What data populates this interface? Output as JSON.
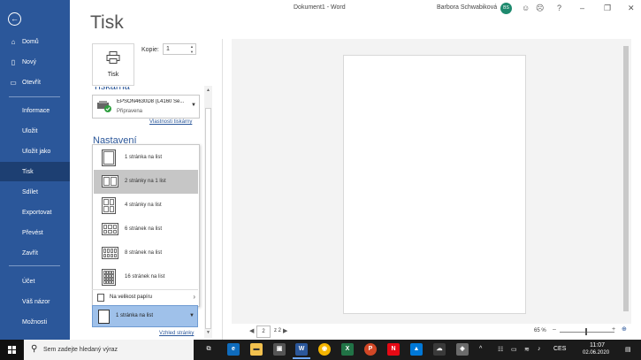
{
  "window": {
    "title": "Dokument1 - Word",
    "user": "Barbora Schwabiková",
    "initials": "BS"
  },
  "nav": {
    "items": [
      "Domů",
      "Nový",
      "Otevřít",
      "Informace",
      "Uložit",
      "Uložit jako",
      "Tisk",
      "Sdílet",
      "Exportovat",
      "Převést",
      "Zavřít",
      "Účet",
      "Váš názor",
      "Možnosti"
    ],
    "selected": "Tisk"
  },
  "page_title": "Tisk",
  "print": {
    "button_label": "Tisk",
    "copies_label": "Kopie:",
    "copies_value": "1"
  },
  "printer": {
    "section": "Tiskárna",
    "name": "EPSON4630D8 (L4160 Se...",
    "status": "Připravena",
    "properties_link": "Vlastnosti tiskárny"
  },
  "settings": {
    "section": "Nastavení",
    "pages_per_sheet_options": [
      "1 stránka na list",
      "2 stránky na 1 list",
      "4 stránky na list",
      "6 stránek na list",
      "8 stránek na list",
      "16 stránek na list"
    ],
    "highlighted_option": "2 stránky na 1 list",
    "fit_paper": "Na velikost papíru",
    "current_value": "1 stránka na list",
    "page_setup_link": "Vzhled stránky"
  },
  "status": {
    "page": "2",
    "of": "z 2",
    "zoom": "65 %"
  },
  "taskbar": {
    "search_placeholder": "Sem zadejte hledaný výraz",
    "lang": "CES",
    "time": "11:07",
    "date": "02.06.2020"
  },
  "colors": {
    "accent": "#2b579a",
    "nav_selected": "#1d3f72",
    "current_select": "#9fc1ea",
    "highlight": "#c6c6c6"
  }
}
